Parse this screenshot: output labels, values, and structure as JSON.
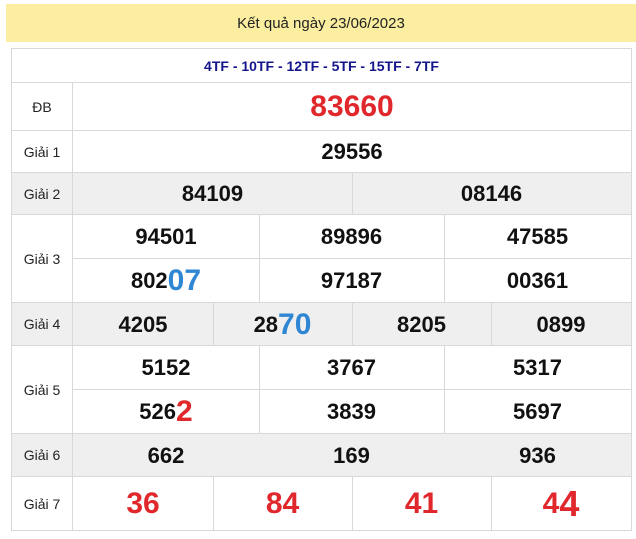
{
  "header": {
    "title": "Kết quả ngày 23/06/2023"
  },
  "codes": "4TF - 10TF - 12TF - 5TF - 15TF - 7TF",
  "labels": {
    "db": "ĐB",
    "g1": "Giải 1",
    "g2": "Giải 2",
    "g3": "Giải 3",
    "g4": "Giải 4",
    "g5": "Giải 5",
    "g6": "Giải 6",
    "g7": "Giải 7"
  },
  "prizes": {
    "db": "83660",
    "g1": "29556",
    "g2": [
      "84109",
      "08146"
    ],
    "g3": [
      {
        "head": "94501",
        "tail": ""
      },
      {
        "head": "89896",
        "tail": ""
      },
      {
        "head": "47585",
        "tail": ""
      },
      {
        "head": "802",
        "tail": "07"
      },
      {
        "head": "97187",
        "tail": ""
      },
      {
        "head": "00361",
        "tail": ""
      }
    ],
    "g4": [
      {
        "head": "4205",
        "tail": ""
      },
      {
        "head": "28",
        "tail": "70"
      },
      {
        "head": "8205",
        "tail": ""
      },
      {
        "head": "0899",
        "tail": ""
      }
    ],
    "g5": [
      {
        "head": "5152",
        "tail": ""
      },
      {
        "head": "3767",
        "tail": ""
      },
      {
        "head": "5317",
        "tail": ""
      },
      {
        "head": "526",
        "tail": "2"
      },
      {
        "head": "3839",
        "tail": ""
      },
      {
        "head": "5697",
        "tail": ""
      }
    ],
    "g6": [
      "662",
      "169",
      "936"
    ],
    "g7": [
      {
        "head": "36",
        "tail": ""
      },
      {
        "head": "84",
        "tail": ""
      },
      {
        "head": "41",
        "tail": ""
      },
      {
        "head": "4",
        "tail": "4"
      }
    ]
  },
  "colors": {
    "title_bg": "#fbeea0",
    "special_red": "#e0282c",
    "highlight_blue": "#2f86d3",
    "codes_navy": "#15158c",
    "row_gray": "#efefef"
  }
}
